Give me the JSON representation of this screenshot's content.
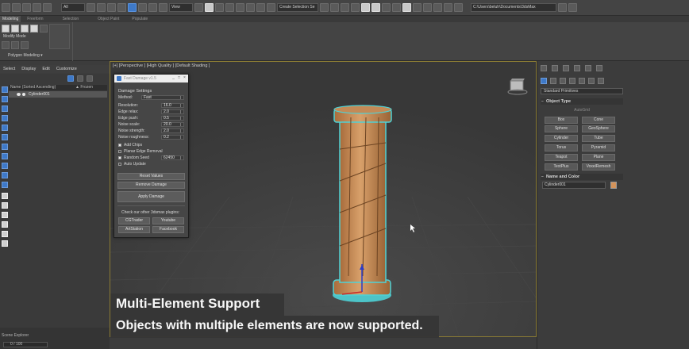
{
  "toolbar": {
    "filter_dropdown": "All",
    "view_dropdown": "View",
    "selection_set_dropdown": "Create Selection Se",
    "project_path": "C:\\Users\\beluh\\Documents\\3dsMax"
  },
  "ribbon": {
    "tabs": [
      "Modeling",
      "Freeform",
      "Selection",
      "Object Paint",
      "Populate"
    ],
    "active_tab": "Modeling",
    "modify_mode": "Modify Mode",
    "polygon_modeling": "Polygon Modeling ▾"
  },
  "menu": {
    "items": [
      "Select",
      "Display",
      "Edit",
      "Customize"
    ]
  },
  "scene_explorer": {
    "col_name": "Name (Sorted Ascending)",
    "col_frozen": "▲ Frozen",
    "row_name": "Cylinder001",
    "tab_label": "Scene Explorer",
    "frames": "0 / 100"
  },
  "viewport": {
    "label": "[+] [Perspective ] [High Quality ] [Default Shading ]"
  },
  "dialog": {
    "title": "Fast Damage v1.5",
    "section": "Damage Settings",
    "method_label": "Method:",
    "method_value": "Fast",
    "params": [
      {
        "label": "Resolution:",
        "value": "16.0"
      },
      {
        "label": "Edge relax:",
        "value": "2.0"
      },
      {
        "label": "Edge push:",
        "value": "0.5"
      },
      {
        "label": "Noise scale:",
        "value": "20.0"
      },
      {
        "label": "Noise strength:",
        "value": "2.0"
      },
      {
        "label": "Noise roughness:",
        "value": "0.2"
      }
    ],
    "add_chips": "Add Chips",
    "planar_edge_removal": "Planar Edge Removal",
    "random_seed": "Random Seed",
    "seed_value": "62450",
    "auto_update": "Auto Update",
    "reset_values": "Reset Values",
    "remove_damage": "Remove Damage",
    "apply_damage": "Apply Damage",
    "plugins_text": "Check our other 3dsmax plugins:",
    "cgtrader": "CGTrader",
    "youtube": "Youtube",
    "artstation": "ArtStation",
    "facebook": "Facebook"
  },
  "command_panel": {
    "category_dropdown": "Standard Primitives",
    "object_type_header": "Object Type",
    "autogrid": "AutoGrid",
    "buttons": [
      "Box",
      "Cone",
      "Sphere",
      "GeoSphere",
      "Cylinder",
      "Tube",
      "Torus",
      "Pyramid",
      "Teapot",
      "Plane",
      "TextPlus",
      "VoxelRemesh"
    ],
    "name_color_header": "Name and Color",
    "object_name": "Cylinder001",
    "object_color": "#d4935a"
  },
  "captions": {
    "title": "Multi-Element Support",
    "subtitle": "Objects with multiple elements are now supported."
  },
  "colors": {
    "accent_blue": "#3e79c8",
    "viewport_border": "#8a7b34",
    "column_orange": "#c98e5b",
    "selection_outline": "#4ed2d6"
  }
}
